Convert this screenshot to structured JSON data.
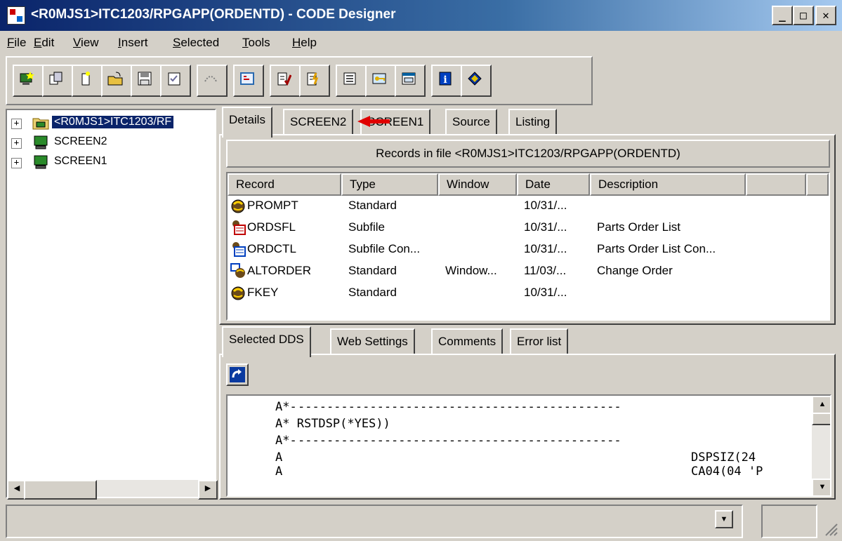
{
  "window": {
    "title": "<R0MJS1>ITC1203/RPGAPP(ORDENTD) - CODE Designer",
    "minimize_label": "_",
    "maximize_label": "□",
    "close_label": "✕"
  },
  "menu": {
    "items": [
      {
        "key": "F",
        "rest": "ile"
      },
      {
        "key": "E",
        "rest": "dit"
      },
      {
        "key": "V",
        "rest": "iew"
      },
      {
        "key": "I",
        "rest": "nsert"
      },
      {
        "key": "S",
        "rest": "elected"
      },
      {
        "key": "T",
        "rest": "ools"
      },
      {
        "key": "H",
        "rest": "elp"
      }
    ]
  },
  "toolbar": {
    "buttons": [
      {
        "icon": "new-record-icon",
        "color": "#2a7a2a"
      },
      {
        "icon": "copy-record-icon",
        "color": "#4a4a9a"
      },
      {
        "icon": "new-file-icon",
        "color": "#c8a000"
      },
      {
        "icon": "open-folder-icon",
        "color": "#c89000"
      },
      {
        "icon": "save-icon",
        "color": "#404040"
      },
      {
        "icon": "checklist-icon",
        "color": "#6a6a9a"
      },
      {
        "icon": "connect-icon",
        "color": "#808080"
      },
      {
        "icon": "screen-layout-icon",
        "color": "#2a6ab0"
      },
      {
        "icon": "verify-icon",
        "color": "#a00000"
      },
      {
        "icon": "verify-all-icon",
        "color": "#a08000"
      },
      {
        "icon": "properties-icon",
        "color": "#505050"
      },
      {
        "icon": "keys-icon",
        "color": "#b08000"
      },
      {
        "icon": "preview-icon",
        "color": "#0060a0"
      },
      {
        "icon": "info-icon",
        "color": "#0040c0"
      },
      {
        "icon": "tag-icon",
        "color": "#c00000"
      }
    ]
  },
  "tree": {
    "nodes": [
      {
        "label": "<R0MJS1>ITC1203/RF",
        "selected": true,
        "expander": "+"
      },
      {
        "label": "SCREEN2",
        "selected": false,
        "expander": "+"
      },
      {
        "label": "SCREEN1",
        "selected": false,
        "expander": "+"
      }
    ]
  },
  "top_tabs": [
    "Details",
    "SCREEN2",
    "SCREEN1",
    "Source",
    "Listing"
  ],
  "records": {
    "header": "Records in file <R0MJS1>ITC1203/RPGAPP(ORDENTD)",
    "columns": [
      "Record",
      "Type",
      "Window",
      "Date",
      "Description"
    ],
    "rows": [
      {
        "icon": "standard-record-icon",
        "record": "PROMPT",
        "type": "Standard",
        "window": "",
        "date": "10/31/...",
        "description": ""
      },
      {
        "icon": "subfile-record-icon",
        "record": "ORDSFL",
        "type": "Subfile",
        "window": "",
        "date": "10/31/...",
        "description": "Parts Order List"
      },
      {
        "icon": "subfile-control-icon",
        "record": "ORDCTL",
        "type": "Subfile Con...",
        "window": "",
        "date": "10/31/...",
        "description": "Parts Order List Con..."
      },
      {
        "icon": "window-record-icon",
        "record": "ALTORDER",
        "type": "Standard",
        "window": "Window...",
        "date": "11/03/...",
        "description": "Change Order"
      },
      {
        "icon": "standard-record-icon",
        "record": "FKEY",
        "type": "Standard",
        "window": "",
        "date": "10/31/...",
        "description": ""
      }
    ]
  },
  "bottom_tabs": [
    "Selected DDS",
    "Web Settings",
    "Comments",
    "Error list"
  ],
  "dds": {
    "lines": [
      {
        "left": "A*-",
        "right": "---------------------------------------------"
      },
      {
        "left": "A* RSTDSP(*YES))",
        "right": ""
      },
      {
        "left": "A*-",
        "right": "---------------------------------------------"
      },
      {
        "left": "A",
        "right": "DSPSIZ(24"
      },
      {
        "left": "A",
        "right": "CA04(04 'P"
      }
    ]
  },
  "colors": {
    "accent": "#0a246a",
    "arrow": "#e00000",
    "face": "#d4d0c8"
  }
}
